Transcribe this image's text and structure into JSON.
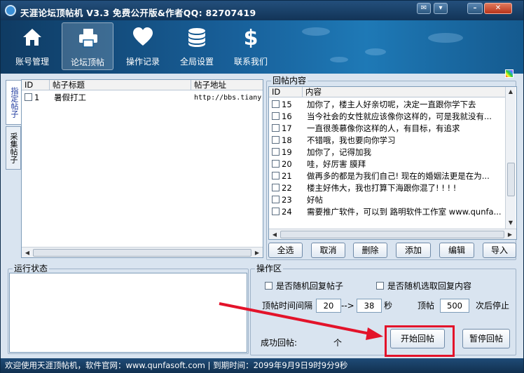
{
  "window": {
    "title": "天涯论坛顶帖机 V3.3 免费公开版&作者QQ: 82707419",
    "controls": [
      "chat-icon",
      "menu-icon",
      "minimize-icon",
      "close-icon"
    ]
  },
  "toolbar": {
    "items": [
      {
        "label": "账号管理",
        "icon": "house-icon"
      },
      {
        "label": "论坛顶帖",
        "icon": "printer-icon",
        "active": true
      },
      {
        "label": "操作记录",
        "icon": "heart-icon"
      },
      {
        "label": "全局设置",
        "icon": "coins-icon"
      },
      {
        "label": "联系我们",
        "icon": "dollar-icon"
      }
    ]
  },
  "side_tabs": [
    "指定帖子",
    "采集帖子"
  ],
  "posts_table": {
    "columns": [
      "ID",
      "帖子标题",
      "帖子地址"
    ],
    "rows": [
      {
        "id": "1",
        "title": "暑假打工",
        "url": "http://bbs.tiany"
      }
    ]
  },
  "reply_content": {
    "group_title": "回帖内容",
    "columns": [
      "ID",
      "内容"
    ],
    "rows": [
      {
        "id": "15",
        "text": "加你了，楼主人好亲切呢，决定一直跟你学下去"
      },
      {
        "id": "16",
        "text": "当今社会的女性就应该像你这样的，可是我就没有..."
      },
      {
        "id": "17",
        "text": "一直很羡慕像你这样的人，有目标，有追求"
      },
      {
        "id": "18",
        "text": "不错哦，我也要向你学习"
      },
      {
        "id": "19",
        "text": "加你了，记得加我"
      },
      {
        "id": "20",
        "text": "哇，好厉害 膜拜"
      },
      {
        "id": "21",
        "text": "做再多的都是为我们自己! 现在的婚姻法更是在为..."
      },
      {
        "id": "22",
        "text": "楼主好伟大，我也打算下海跟你混了! ! ! !"
      },
      {
        "id": "23",
        "text": "好帖"
      },
      {
        "id": "24",
        "text": "需要推广软件，可以到 路明软件工作室 www.qunfa..."
      }
    ],
    "buttons": [
      "全选",
      "取消",
      "删除",
      "添加",
      "编辑",
      "导入"
    ]
  },
  "run_status": {
    "group_title": "运行状态"
  },
  "operations": {
    "group_title": "操作区",
    "random_reply_post": "是否随机回复帖子",
    "random_reply_content": "是否随机选取回复内容",
    "interval_label": "顶帖时间间隔",
    "interval_from": "20",
    "interval_sep": "-->",
    "interval_to": "38",
    "interval_unit": "秒",
    "top_label": "顶帖",
    "top_count": "500",
    "top_suffix": "次后停止",
    "success_label": "成功回帖:",
    "success_unit": "个",
    "start_button": "开始回帖",
    "pause_button": "暂停回帖"
  },
  "statusbar": {
    "text": "欢迎使用天涯顶帖机，软件官网：www.qunfasoft.com  | 到期时间：2099年9月9日9时9分9秒"
  },
  "colors": {
    "title_bg": "#123457",
    "toolbar_bg": "#18609a",
    "window_bg": "#d9e4f0",
    "highlight": "#e3132a"
  }
}
